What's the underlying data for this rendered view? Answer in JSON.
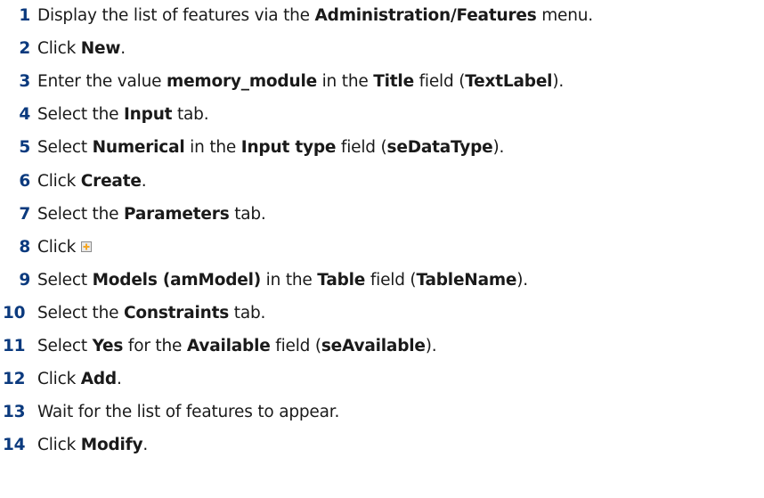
{
  "steps": [
    {
      "num": "1",
      "parts": [
        {
          "t": "Display the list of features via the "
        },
        {
          "t": "Administration/Features",
          "b": true
        },
        {
          "t": " menu."
        }
      ]
    },
    {
      "num": "2",
      "parts": [
        {
          "t": "Click "
        },
        {
          "t": "New",
          "b": true
        },
        {
          "t": "."
        }
      ]
    },
    {
      "num": "3",
      "parts": [
        {
          "t": "Enter the value "
        },
        {
          "t": "memory_module",
          "b": true
        },
        {
          "t": " in the "
        },
        {
          "t": "Title",
          "b": true
        },
        {
          "t": " field ("
        },
        {
          "t": "TextLabel",
          "b": true
        },
        {
          "t": ")."
        }
      ]
    },
    {
      "num": "4",
      "parts": [
        {
          "t": "Select the "
        },
        {
          "t": "Input",
          "b": true
        },
        {
          "t": " tab."
        }
      ]
    },
    {
      "num": "5",
      "parts": [
        {
          "t": "Select "
        },
        {
          "t": "Numerical",
          "b": true
        },
        {
          "t": " in the "
        },
        {
          "t": "Input type",
          "b": true
        },
        {
          "t": " field ("
        },
        {
          "t": "seDataType",
          "b": true
        },
        {
          "t": ")."
        }
      ]
    },
    {
      "num": "6",
      "parts": [
        {
          "t": "Click "
        },
        {
          "t": "Create",
          "b": true
        },
        {
          "t": "."
        }
      ]
    },
    {
      "num": "7",
      "parts": [
        {
          "t": "Select the "
        },
        {
          "t": "Parameters",
          "b": true
        },
        {
          "t": " tab."
        }
      ]
    },
    {
      "num": "8",
      "parts": [
        {
          "t": "Click"
        }
      ],
      "icon": "add-plus-icon"
    },
    {
      "num": "9",
      "parts": [
        {
          "t": "Select "
        },
        {
          "t": "Models (amModel)",
          "b": true
        },
        {
          "t": " in the "
        },
        {
          "t": "Table",
          "b": true
        },
        {
          "t": " field ("
        },
        {
          "t": "TableName",
          "b": true
        },
        {
          "t": ")."
        }
      ]
    },
    {
      "num": "10",
      "parts": [
        {
          "t": "Select the "
        },
        {
          "t": "Constraints",
          "b": true
        },
        {
          "t": " tab."
        }
      ]
    },
    {
      "num": "11",
      "parts": [
        {
          "t": "Select "
        },
        {
          "t": "Yes",
          "b": true
        },
        {
          "t": " for the "
        },
        {
          "t": "Available",
          "b": true
        },
        {
          "t": " field ("
        },
        {
          "t": "seAvailable",
          "b": true
        },
        {
          "t": ")."
        }
      ]
    },
    {
      "num": "12",
      "parts": [
        {
          "t": "Click "
        },
        {
          "t": "Add",
          "b": true
        },
        {
          "t": "."
        }
      ]
    },
    {
      "num": "13",
      "parts": [
        {
          "t": "Wait for the list of features to appear."
        }
      ]
    },
    {
      "num": "14",
      "parts": [
        {
          "t": "Click "
        },
        {
          "t": "Modify",
          "b": true
        },
        {
          "t": "."
        }
      ]
    }
  ],
  "colors": {
    "step_number": "#0b3a7e",
    "text": "#1a1a1a",
    "icon_fill": "#f5a623",
    "icon_border": "#8c8c8c"
  }
}
